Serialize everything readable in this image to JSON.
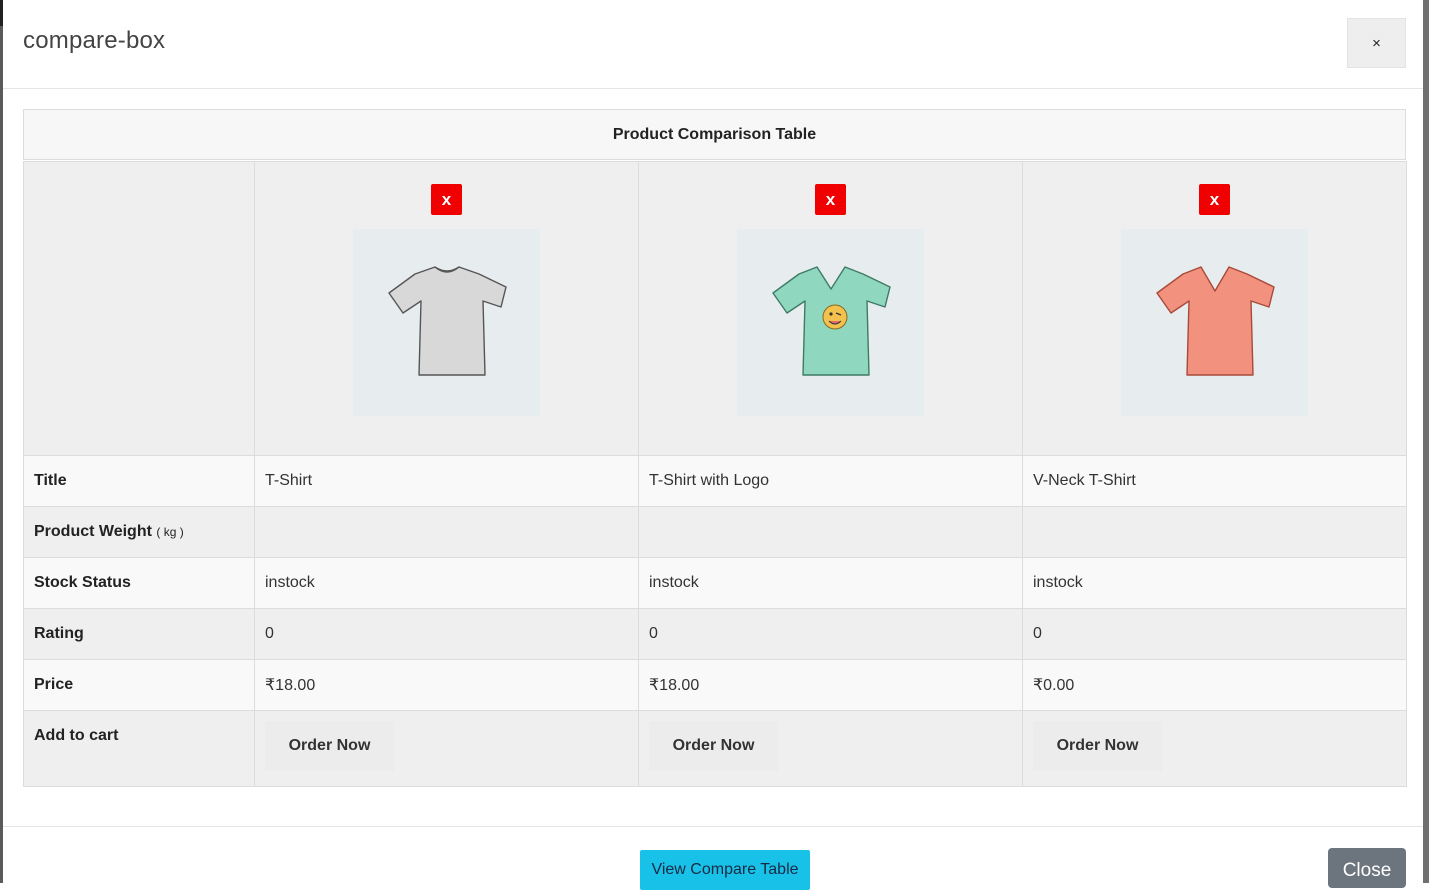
{
  "modal": {
    "title": "compare-box",
    "close_icon": "×"
  },
  "table": {
    "caption": "Product Comparison Table",
    "remove_label": "x",
    "products": [
      {
        "title": "T-Shirt",
        "weight": "",
        "stock": "instock",
        "rating": "0",
        "price": "₹18.00",
        "order_label": "Order Now",
        "image": "grey-tshirt-image",
        "shirt_color": "#d8d8d8"
      },
      {
        "title": "T-Shirt with Logo",
        "weight": "",
        "stock": "instock",
        "rating": "0",
        "price": "₹18.00",
        "order_label": "Order Now",
        "image": "mint-tshirt-with-emoji-logo-image",
        "shirt_color": "#8fd8bf"
      },
      {
        "title": "V-Neck T-Shirt",
        "weight": "",
        "stock": "instock",
        "rating": "0",
        "price": "₹0.00",
        "order_label": "Order Now",
        "image": "coral-vneck-tshirt-image",
        "shirt_color": "#f2917d"
      }
    ],
    "labels": {
      "title": "Title",
      "weight": "Product Weight",
      "weight_unit": "( kg )",
      "stock": "Stock Status",
      "rating": "Rating",
      "price": "Price",
      "cart": "Add to cart"
    }
  },
  "footer": {
    "view_compare_label": "View Compare Table",
    "close_label": "Close"
  },
  "colors": {
    "remove_red": "#f00000",
    "view_button_cyan": "#17c1e8",
    "close_button_grey": "#6c757d"
  }
}
